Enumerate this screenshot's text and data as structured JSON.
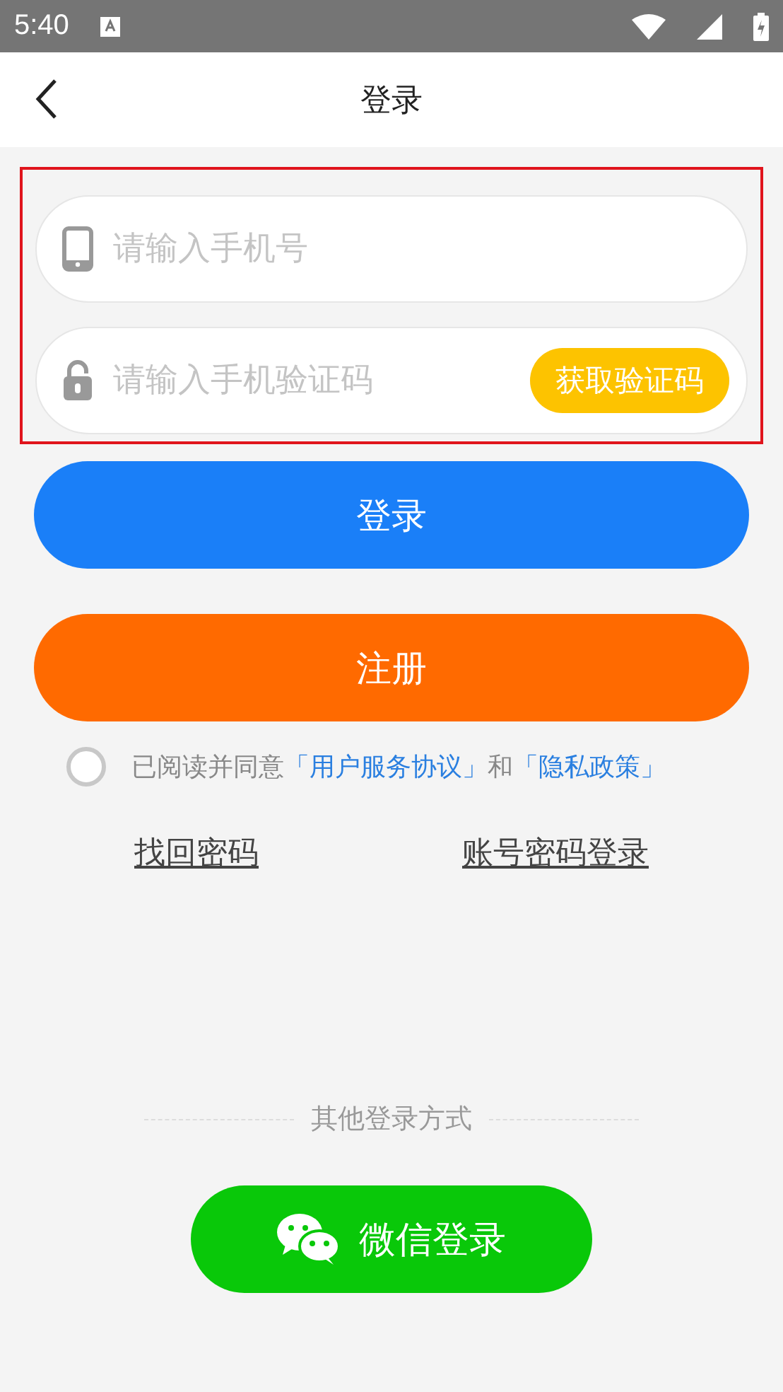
{
  "status_bar": {
    "time": "5:40"
  },
  "header": {
    "title": "登录"
  },
  "phone_field": {
    "placeholder": "请输入手机号"
  },
  "code_field": {
    "placeholder": "请输入手机验证码",
    "button": "获取验证码"
  },
  "login_button": "登录",
  "register_button": "注册",
  "agreement": {
    "checked": false,
    "prefix": "已阅读并同意",
    "terms_link": "「用户服务协议」",
    "joiner": "和",
    "privacy_link": "「隐私政策」"
  },
  "links": [
    {
      "label": "找回密码"
    },
    {
      "label": "账号密码登录"
    }
  ],
  "other_login": {
    "label": "其他登录方式",
    "wechat_button": "微信登录"
  }
}
